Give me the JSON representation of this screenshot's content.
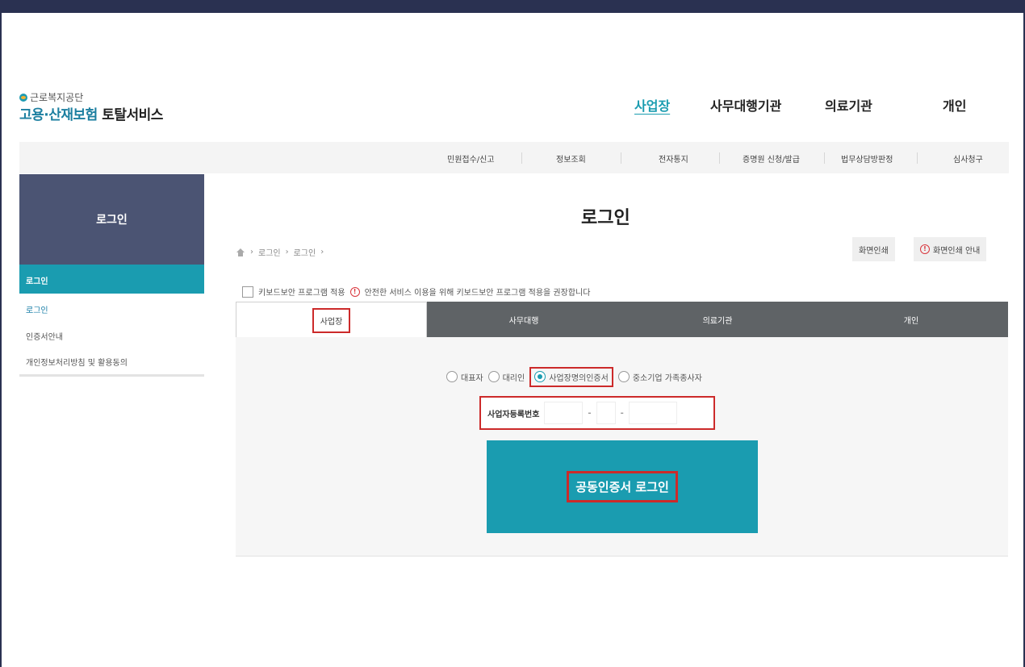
{
  "logo": {
    "org": "근로복지공단",
    "service_prefix": "고용·산재보험",
    "service_suffix": "토탈서비스"
  },
  "topnav": [
    "사업장",
    "사무대행기관",
    "의료기관",
    "개인"
  ],
  "topnav_active": "사업장",
  "subnav": [
    "민원접수/신고",
    "정보조회",
    "전자통지",
    "증명원 신청/발급",
    "법무상담방판정",
    "심사청구"
  ],
  "sidebar": {
    "title": "로그인",
    "section": "로그인",
    "items": [
      "로그인",
      "인증서안내",
      "개인정보처리방침 및 활용동의"
    ]
  },
  "page": {
    "title": "로그인",
    "breadcrumb": [
      "로그인",
      "로그인"
    ],
    "print_button": "화면인쇄",
    "print_guide_button": "화면인쇄 안내",
    "warn_glyph": "!"
  },
  "keyboard_security": {
    "label": "키보드보안 프로그램 적용",
    "notice": "안전한 서비스 이용을 위해 키보드보안 프로그램 적용을 권장합니다"
  },
  "tabs": [
    "사업장",
    "사무대행",
    "의료기관",
    "개인"
  ],
  "tab_active": "사업장",
  "login_types": [
    "대표자",
    "대리인",
    "사업장명의인증서",
    "중소기업 가족종사자"
  ],
  "login_type_selected": "사업장명의인증서",
  "biz_reg": {
    "label": "사업자등록번호",
    "separator": "-"
  },
  "login_button": "공동인증서 로그인",
  "colors": {
    "accent": "#1a9cb0",
    "sidebar_head": "#4b5473",
    "highlight": "#cc2a2a",
    "tabbar": "#5f6366"
  }
}
